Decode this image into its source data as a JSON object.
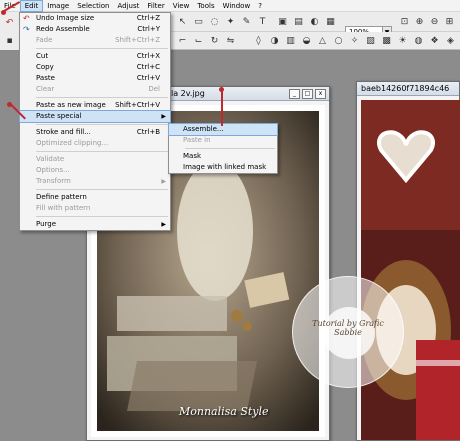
{
  "menubar": {
    "items": [
      "File",
      "Edit",
      "Image",
      "Selection",
      "Adjust",
      "Filter",
      "View",
      "Tools",
      "Window",
      "?"
    ],
    "active_index": 1
  },
  "toolbar": {
    "zoom_value": "100%"
  },
  "edit_menu": {
    "items": [
      {
        "label": "Undo Image size",
        "shortcut": "Ctrl+Z",
        "enabled": true,
        "icon": "undo-icon"
      },
      {
        "label": "Redo Assemble",
        "shortcut": "Ctrl+Y",
        "enabled": true,
        "icon": "redo-icon"
      },
      {
        "label": "Fade",
        "shortcut": "Shift+Ctrl+Z",
        "enabled": false
      },
      {
        "sep": true
      },
      {
        "label": "Cut",
        "shortcut": "Ctrl+X",
        "enabled": true
      },
      {
        "label": "Copy",
        "shortcut": "Ctrl+C",
        "enabled": true
      },
      {
        "label": "Paste",
        "shortcut": "Ctrl+V",
        "enabled": true
      },
      {
        "label": "Clear",
        "shortcut": "Del",
        "enabled": false
      },
      {
        "sep": true
      },
      {
        "label": "Paste as new image",
        "shortcut": "Shift+Ctrl+V",
        "enabled": true
      },
      {
        "label": "Paste special",
        "shortcut": "",
        "enabled": true,
        "submenu": true,
        "highlighted": true
      },
      {
        "sep": true
      },
      {
        "label": "Stroke and fill...",
        "shortcut": "Ctrl+B",
        "enabled": true
      },
      {
        "label": "Optimized clipping...",
        "shortcut": "",
        "enabled": false
      },
      {
        "sep": true
      },
      {
        "label": "Validate",
        "shortcut": "",
        "enabled": false
      },
      {
        "label": "Options...",
        "shortcut": "",
        "enabled": false
      },
      {
        "label": "Transform",
        "shortcut": "",
        "enabled": false,
        "submenu": true
      },
      {
        "sep": true
      },
      {
        "label": "Define pattern",
        "shortcut": "",
        "enabled": true
      },
      {
        "label": "Fill with pattern",
        "shortcut": "",
        "enabled": false
      },
      {
        "sep": true
      },
      {
        "label": "Purge",
        "shortcut": "",
        "enabled": true,
        "submenu": true
      }
    ]
  },
  "paste_special_submenu": {
    "items": [
      {
        "label": "Assemble...",
        "enabled": true,
        "highlighted": true
      },
      {
        "label": "Paste in",
        "enabled": false
      },
      {
        "sep": true
      },
      {
        "label": "Mask",
        "enabled": true
      },
      {
        "label": "Image with linked mask",
        "enabled": true
      }
    ]
  },
  "doc_window_1": {
    "title": "la 2v.jpg",
    "buttons": [
      "_",
      "□",
      "x"
    ]
  },
  "doc_window_2": {
    "title": "baeb14260f71894c46"
  },
  "watermarks": {
    "signature": "Monnalisa Style",
    "stamp_text": "Tutorial by Grafic Sabbie"
  },
  "colors": {
    "menu_highlight": "#cfe3f7",
    "annotation_red": "#c0282d"
  }
}
